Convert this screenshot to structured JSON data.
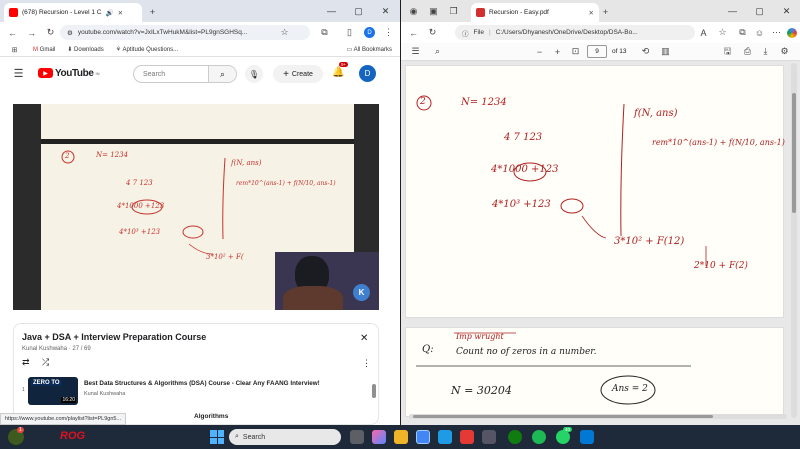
{
  "left": {
    "tab_title": "(678) Recursion - Level 1 C",
    "url": "youtube.com/watch?v=JxILxTwHukM&list=PL9gnSGHSq...",
    "profile": "D",
    "bookmarks": [
      "Gmail",
      "Downloads",
      "Aptitude Questions..."
    ],
    "all_bookmarks": "All Bookmarks",
    "yt_logo": "YouTube",
    "yt_region": "IN",
    "search_placeholder": "Search",
    "create": "Create",
    "notif_count": "9+",
    "avatar": "D",
    "playlist_title": "Java + DSA + Interview Preparation Course",
    "playlist_meta": "Kunal Kushwaha · 27 / 69",
    "item1_title": "Best Data Structures & Algorithms (DSA) Course - Clear Any FAANG Interview!",
    "item1_channel": "Kunal Kushwaha",
    "item1_duration": "16:20",
    "item1_thumb": "ZERO TO",
    "item2_title_fragment": "Algorithms",
    "status_url": "https://www.youtube.com/playlist?list=PL9gn5...",
    "video_notes": [
      "N= 1234",
      "4 7 123",
      "4*1000 +123",
      "4*10³ +123",
      "3*10² + F(",
      "f(N, ans)",
      "rem*10^(ans-1) + f(N/10, ans-1)"
    ]
  },
  "right": {
    "tab_title": "Recursion - Easy.pdf",
    "file_label": "File",
    "path": "C:/Users/Dhyanesh/OneDrive/Desktop/DSA-Bo...",
    "page_current": "9",
    "page_total": "of 13",
    "page1_notes": [
      "N= 1234",
      "4 7 123",
      "4*1000 +123",
      "4*10³ +123",
      "3*10² + F(12)",
      "2*10 + F(2)",
      "f(N, ans)",
      "rem*10^(ans-1) + f(N/10, ans-1)"
    ],
    "page2_notes": {
      "q": "Q:",
      "imp": "Imp wrught",
      "question": "Count no of zeros in a number.",
      "n": "N = 30204",
      "ans": "Ans = 2"
    }
  },
  "taskbar": {
    "search": "Search",
    "badge": "1",
    "badge2": "40",
    "brand": "ROG"
  }
}
